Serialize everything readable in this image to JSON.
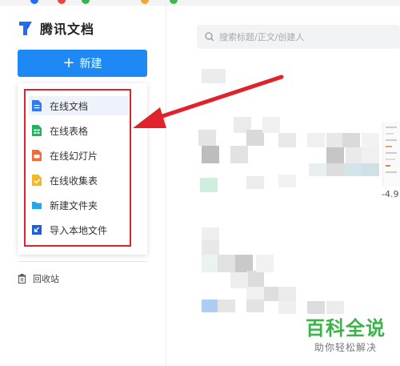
{
  "app": {
    "title": "腾讯文档"
  },
  "sidebar": {
    "new_button_label": "新建",
    "menu": [
      {
        "label": "在线文档",
        "icon": "doc-icon",
        "color": "#2b7cf6"
      },
      {
        "label": "在线表格",
        "icon": "sheet-icon",
        "color": "#22b35c"
      },
      {
        "label": "在线幻灯片",
        "icon": "slides-icon",
        "color": "#f26b3a"
      },
      {
        "label": "在线收集表",
        "icon": "form-icon",
        "color": "#f5b629"
      },
      {
        "label": "新建文件夹",
        "icon": "folder-icon",
        "color": "#2ba3e8"
      },
      {
        "label": "导入本地文件",
        "icon": "import-icon",
        "color": "#1f5fd6"
      }
    ],
    "trash_label": "回收站"
  },
  "search": {
    "placeholder": "搜索标题/正文/创建人"
  },
  "main": {
    "peek_value": "-4.9"
  },
  "watermark": {
    "title": "百科全说",
    "subtitle": "助你轻松解决"
  },
  "colors": {
    "accent": "#1e88f5",
    "highlight_outline": "#e0232a",
    "arrow": "#e0232a",
    "watermark": "#3cb34a"
  }
}
